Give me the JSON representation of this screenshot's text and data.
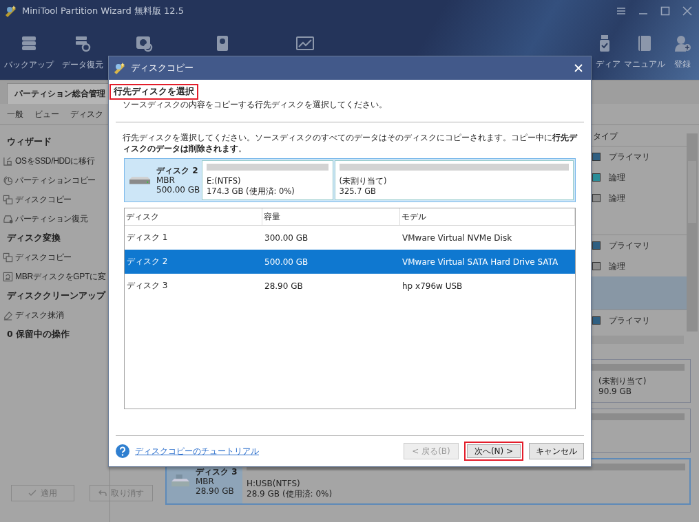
{
  "app": {
    "title": "MiniTool Partition Wizard 無料版 12.5",
    "toolbar_left": [
      "バックアップ",
      "データ復元"
    ],
    "toolbar_right": [
      "ディア",
      "マニュアル",
      "登録"
    ],
    "tab": "パーティション総合管理",
    "menu": [
      "一般",
      "ビュー",
      "ディスク"
    ],
    "sidebar": [
      {
        "title": "ウィザード",
        "items": [
          {
            "label": "OSをSSD/HDDに移行",
            "kind": "migrate"
          },
          {
            "label": "パーティションコピー",
            "kind": "partcopy"
          },
          {
            "label": "ディスクコピー",
            "kind": "diskcopy"
          },
          {
            "label": "パーティション復元",
            "kind": "recover"
          }
        ]
      },
      {
        "title": "ディスク変換",
        "items": [
          {
            "label": "ディスクコピー",
            "kind": "diskcopy"
          },
          {
            "label": "MBRディスクをGPTに変",
            "kind": "convert"
          }
        ]
      },
      {
        "title": "ディスククリーンアップ",
        "items": [
          {
            "label": "ディスク抹消",
            "kind": "wipe"
          }
        ]
      }
    ],
    "pending": "0 保留中の操作",
    "actions": [
      {
        "label": "適用",
        "kind": "apply",
        "disabled": true
      },
      {
        "label": "取り消す",
        "kind": "undo",
        "disabled": true
      }
    ],
    "partition_header": "タイプ",
    "partition_rows": [
      {
        "kind": "partition",
        "type": "プライマリ",
        "color": "#2f5f82",
        "selected": false
      },
      {
        "kind": "partition",
        "type": "論理",
        "color": "#2a8d99",
        "selected": false
      },
      {
        "kind": "partition",
        "type": "論理",
        "color": "#8c8c8c",
        "selected": false
      },
      {
        "kind": "disk",
        "selected": false
      },
      {
        "kind": "partition",
        "type": "プライマリ",
        "color": "#2f5f82",
        "selected": false
      },
      {
        "kind": "partition",
        "type": "論理",
        "color": "#8c8c8c",
        "selected": false
      },
      {
        "kind": "disk",
        "selected": true
      },
      {
        "kind": "partition",
        "type": "プライマリ",
        "color": "#2f5f82",
        "selected": false
      }
    ],
    "disk_cards": [
      {
        "kind": "partition",
        "label": "(未割り当て)",
        "size": "90.9 GB"
      },
      {
        "kind": "blank"
      }
    ],
    "usb_disk": {
      "name": "ディスク 3",
      "scheme": "MBR",
      "capacity": "28.90 GB",
      "partition": "H:USB(NTFS)",
      "usage": "28.9 GB (使用済: 0%)",
      "selected": true
    }
  },
  "dialog": {
    "title": "ディスクコピー",
    "heading": "行先ディスクを選択",
    "heading_highlighted": true,
    "subtitle": "ソースディスクの内容をコピーする行先ディスクを選択してください。",
    "instruction": "行先ディスクを選択してください。ソースディスクのすべてのデータはそのディスクにコピーされます。コピー中に**行先ディスクのデータは削除されます**。",
    "target": {
      "name": "ディスク 2",
      "scheme": "MBR",
      "capacity": "500.00 GB",
      "partitions": [
        {
          "label": "E:(NTFS)",
          "size": "174.3 GB (使用済: 0%)"
        },
        {
          "label": "(未割り当て)",
          "size": "325.7 GB"
        }
      ]
    },
    "table": {
      "columns": [
        "ディスク",
        "容量",
        "モデル"
      ],
      "rows": [
        {
          "cells": [
            "ディスク 1",
            "300.00 GB",
            "VMware Virtual NVMe Disk"
          ],
          "selected": false
        },
        {
          "cells": [
            "ディスク 2",
            "500.00 GB",
            "VMware Virtual SATA Hard Drive SATA"
          ],
          "selected": true
        },
        {
          "cells": [
            "ディスク 3",
            "28.90 GB",
            "hp x796w USB"
          ],
          "selected": false
        }
      ]
    },
    "help_link": "ディスクコピーのチュートリアル",
    "buttons": [
      {
        "label": "< 戻る(B)",
        "disabled": true,
        "highlighted": false
      },
      {
        "label": "次へ(N) >",
        "disabled": false,
        "highlighted": true
      },
      {
        "label": "キャンセル",
        "disabled": false,
        "highlighted": false
      }
    ]
  }
}
